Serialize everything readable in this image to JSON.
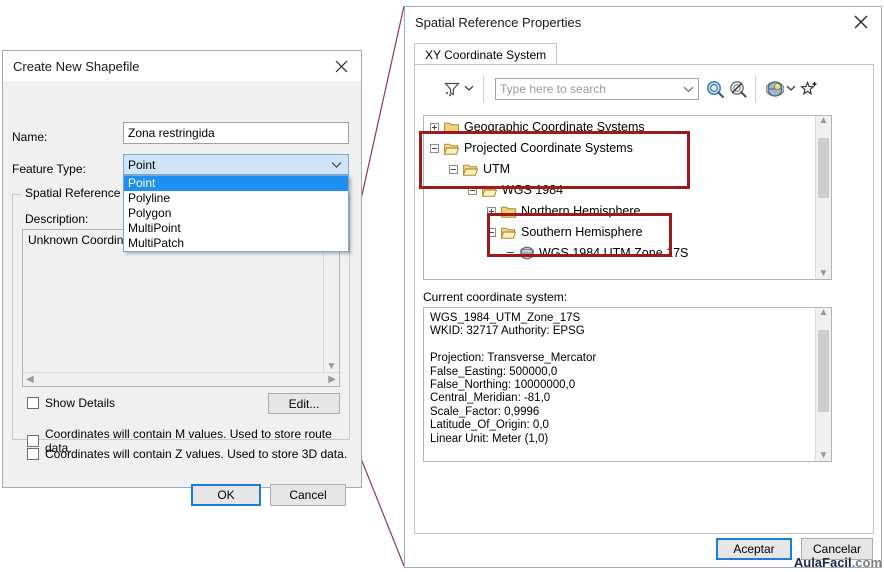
{
  "shapefile_dialog": {
    "title": "Create New Shapefile",
    "close_icon": "close-icon",
    "name_label": "Name:",
    "name_value": "Zona restringida",
    "feature_type_label": "Feature Type:",
    "feature_type_value": "Point",
    "feature_type_options": [
      "Point",
      "Polyline",
      "Polygon",
      "MultiPoint",
      "MultiPatch"
    ],
    "feature_type_selected_index": 0,
    "spatial_reference_label": "Spatial Reference",
    "description_label": "Description:",
    "description_value": "Unknown Coordinate System",
    "show_details_label": "Show Details",
    "show_details_checked": false,
    "edit_button": "Edit...",
    "m_values_label": "Coordinates will contain M values. Used to store route data.",
    "m_values_checked": false,
    "z_values_label": "Coordinates will contain Z values. Used to store 3D data.",
    "z_values_checked": false,
    "ok_button": "OK",
    "cancel_button": "Cancel"
  },
  "spatial_reference_dialog": {
    "title": "Spatial Reference Properties",
    "close_icon": "close-icon",
    "tab_label": "XY Coordinate System",
    "toolbar": {
      "filter_icon": "filter-funnel-icon",
      "filter_dropdown_icon": "chevron-down-icon",
      "search_placeholder": "Type here to search",
      "search_value": "",
      "search_dropdown_icon": "chevron-down-icon",
      "search_button_icon": "search-magnifier-icon",
      "clear_search_icon": "clear-search-icon",
      "globe_icon": "globe-icon",
      "globe_dropdown_icon": "chevron-down-icon",
      "favorite_icon": "add-favorite-star-icon"
    },
    "tree": [
      {
        "label": "Geographic Coordinate Systems",
        "depth": 0,
        "expander": "plus",
        "icon": "folder-closed-icon",
        "highlight": false
      },
      {
        "label": "Projected Coordinate Systems",
        "depth": 0,
        "expander": "minus",
        "icon": "folder-open-icon",
        "highlight": true
      },
      {
        "label": "UTM",
        "depth": 1,
        "expander": "minus",
        "icon": "folder-open-icon",
        "highlight": true
      },
      {
        "label": "WGS 1984",
        "depth": 2,
        "expander": "minus",
        "icon": "folder-open-icon",
        "highlight": true
      },
      {
        "label": "Northern Hemisphere",
        "depth": 3,
        "expander": "plus",
        "icon": "folder-closed-icon",
        "highlight": false
      },
      {
        "label": "Southern Hemisphere",
        "depth": 3,
        "expander": "minus",
        "icon": "folder-open-icon",
        "highlight": true
      },
      {
        "label": "WGS 1984 UTM Zone 17S",
        "depth": 4,
        "expander": "none",
        "icon": "globe-sphere-icon",
        "highlight": true
      }
    ],
    "current_label": "Current coordinate system:",
    "current_text": "WGS_1984_UTM_Zone_17S\nWKID: 32717 Authority: EPSG\n\nProjection: Transverse_Mercator\nFalse_Easting: 500000,0\nFalse_Northing: 10000000,0\nCentral_Meridian: -81,0\nScale_Factor: 0,9996\nLatitude_Of_Origin: 0,0\nLinear Unit: Meter (1,0)",
    "accept_button": "Aceptar",
    "cancel_button": "Cancelar"
  },
  "annotation": {
    "highlight_color": "#9e1b1b",
    "connector_color": "#8d3a4a"
  },
  "watermark": {
    "brand": "AulaFacil",
    "suffix": ".com"
  }
}
